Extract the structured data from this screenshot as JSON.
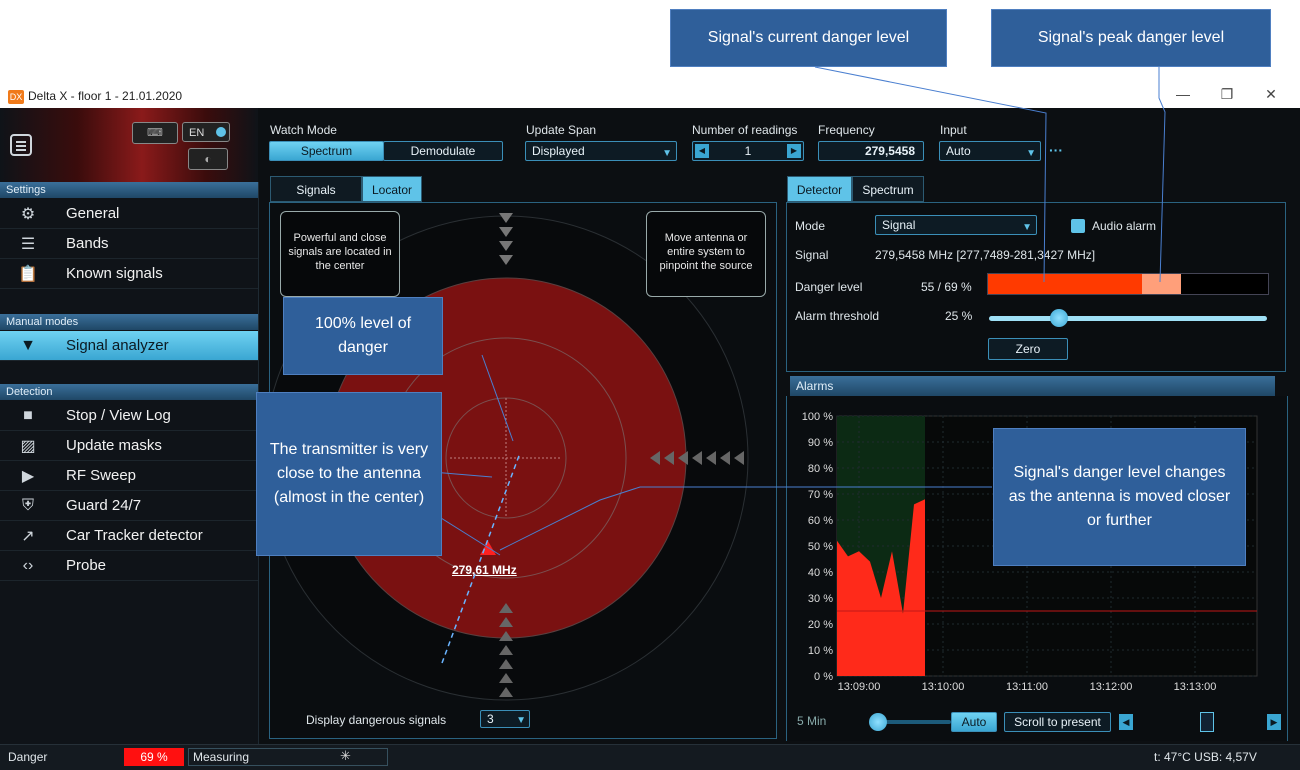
{
  "callouts": {
    "current_level": "Signal's current danger level",
    "peak_level": "Signal's peak danger level",
    "hundred_percent": "100% level of danger",
    "transmitter_close": "The transmitter is very close to the antenna (almost in the center)",
    "level_changes": "Signal's danger level changes as the antenna is moved closer or further"
  },
  "window": {
    "title": "Delta X - floor 1 - 21.01.2020",
    "minimize": "—",
    "restore": "❐",
    "close": "✕"
  },
  "header": {
    "language": "EN",
    "watch_mode": {
      "label": "Watch Mode",
      "options": [
        "Spectrum",
        "Demodulate"
      ],
      "selected": "Spectrum"
    },
    "update_span": {
      "label": "Update Span",
      "value": "Displayed"
    },
    "readings": {
      "label": "Number of readings",
      "value": "1"
    },
    "frequency": {
      "label": "Frequency",
      "value": "279,5458"
    },
    "input": {
      "label": "Input",
      "value": "Auto"
    },
    "more": "···"
  },
  "sidebar": {
    "sections": [
      {
        "title": "Settings",
        "items": [
          {
            "label": "General",
            "icon": "gear-icon"
          },
          {
            "label": "Bands",
            "icon": "list-icon"
          },
          {
            "label": "Known signals",
            "icon": "clipboard-icon"
          }
        ]
      },
      {
        "title": "Manual modes",
        "items": [
          {
            "label": "Signal analyzer",
            "icon": "antenna-icon"
          }
        ]
      },
      {
        "title": "Detection",
        "items": [
          {
            "label": "Stop / View Log",
            "icon": "stop-icon"
          },
          {
            "label": "Update masks",
            "icon": "image-icon"
          },
          {
            "label": "RF Sweep",
            "icon": "play-icon"
          },
          {
            "label": "Guard 24/7",
            "icon": "shield-icon"
          },
          {
            "label": "Car Tracker detector",
            "icon": "trend-icon"
          },
          {
            "label": "Probe",
            "icon": "code-icon"
          }
        ]
      }
    ]
  },
  "locator": {
    "tabs": [
      "Signals",
      "Locator"
    ],
    "active_tab": "Locator",
    "hint_left": "Powerful and close signals are located in the center",
    "hint_right": "Move antenna or entire system to pinpoint the source",
    "signal_label": "279,61 MHz",
    "display_label": "Display dangerous signals",
    "display_value": "3"
  },
  "detector": {
    "tabs": [
      "Detector",
      "Spectrum"
    ],
    "active_tab": "Detector",
    "mode_label": "Mode",
    "mode_value": "Signal",
    "audio_alarm": "Audio alarm",
    "signal_label": "Signal",
    "signal_value": "279,5458 MHz [277,7489-281,3427 MHz]",
    "danger_label": "Danger level",
    "danger_value": "55 / 69 %",
    "danger_current": 55,
    "danger_peak": 69,
    "threshold_label": "Alarm threshold",
    "threshold_value": "25 %",
    "threshold": 25,
    "zero_button": "Zero"
  },
  "alarms": {
    "title": "Alarms",
    "span_label": "5 Min",
    "auto_button": "Auto",
    "scroll_button": "Scroll to present"
  },
  "chart_data": {
    "type": "area",
    "title": "",
    "xlabel": "",
    "ylabel": "",
    "y_ticks": [
      "100 %",
      "90 %",
      "80 %",
      "70 %",
      "60 %",
      "50 %",
      "40 %",
      "30 %",
      "20 %",
      "10 %",
      "0 %"
    ],
    "x_ticks": [
      "13:09:00",
      "13:10:00",
      "13:11:00",
      "13:12:00",
      "13:13:00"
    ],
    "ylim": [
      0,
      100
    ],
    "threshold": 25,
    "x": [
      "13:09:00",
      "13:09:10",
      "13:09:20",
      "13:09:30",
      "13:09:40",
      "13:09:45",
      "13:09:50",
      "13:09:55",
      "13:10:00"
    ],
    "values": [
      52,
      46,
      48,
      44,
      30,
      48,
      24,
      66,
      68
    ],
    "color": "#ff2a1a"
  },
  "status": {
    "danger_label": "Danger",
    "danger_value": "69 %",
    "measuring": "Measuring",
    "temp_usb": "t: 47°C  USB: 4,57V"
  }
}
